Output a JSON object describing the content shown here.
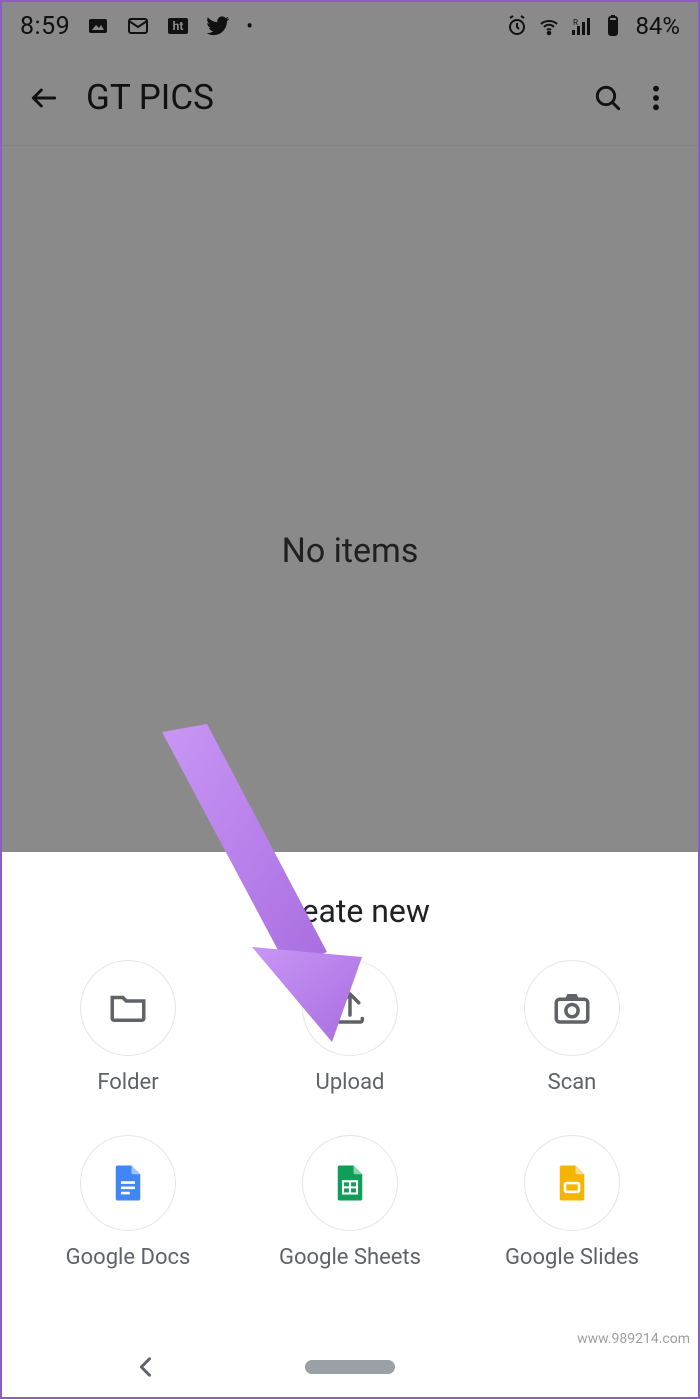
{
  "status": {
    "time": "8:59",
    "battery": "84%"
  },
  "appbar": {
    "title": "GT PICS"
  },
  "main": {
    "empty_text": "No items"
  },
  "sheet": {
    "title": "Create new",
    "items": [
      {
        "label": "Folder",
        "icon": "folder-icon"
      },
      {
        "label": "Upload",
        "icon": "upload-icon"
      },
      {
        "label": "Scan",
        "icon": "camera-icon"
      },
      {
        "label": "Google Docs",
        "icon": "docs-icon"
      },
      {
        "label": "Google Sheets",
        "icon": "sheets-icon"
      },
      {
        "label": "Google Slides",
        "icon": "slides-icon"
      }
    ]
  },
  "watermark": "www.989214.com",
  "colors": {
    "arrow": "#b57cf0",
    "docs": "#4285f4",
    "sheets": "#0f9d58",
    "slides": "#f4b400"
  }
}
